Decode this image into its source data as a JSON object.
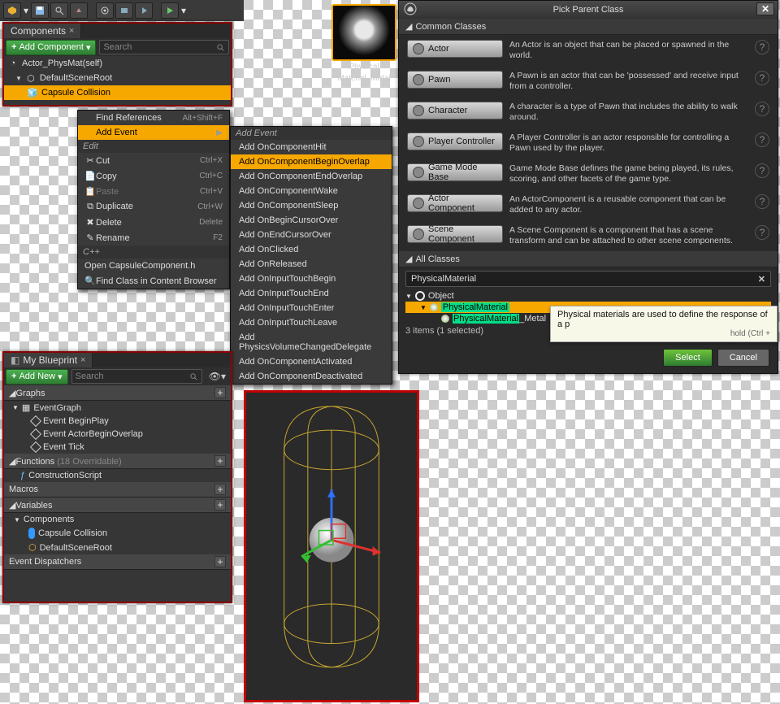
{
  "toolbar": {
    "dropdown": "▾"
  },
  "componentsPanel": {
    "tab": "Components",
    "addButton": "Add Component",
    "searchPlaceholder": "Search",
    "rootItem": "Actor_PhysMat(self)",
    "sceneRoot": "DefaultSceneRoot",
    "capsule": "Capsule Collision"
  },
  "contextMenu": {
    "findRefs": "Find References",
    "findRefsSC": "Alt+Shift+F",
    "addEvent": "Add Event",
    "editHdr": "Edit",
    "cut": "Cut",
    "cutSC": "Ctrl+X",
    "copy": "Copy",
    "copySC": "Ctrl+C",
    "paste": "Paste",
    "pasteSC": "Ctrl+V",
    "duplicate": "Duplicate",
    "duplicateSC": "Ctrl+W",
    "delete": "Delete",
    "deleteSC": "Delete",
    "rename": "Rename",
    "renameSC": "F2",
    "cppHdr": "C++",
    "openH": "Open CapsuleComponent.h",
    "findClass": "Find Class in Content Browser"
  },
  "submenu": {
    "hdr": "Add Event",
    "items": [
      "Add OnComponentHit",
      "Add OnComponentBeginOverlap",
      "Add OnComponentEndOverlap",
      "Add OnComponentWake",
      "Add OnComponentSleep",
      "Add OnBeginCursorOver",
      "Add OnEndCursorOver",
      "Add OnClicked",
      "Add OnReleased",
      "Add OnInputTouchBegin",
      "Add OnInputTouchEnd",
      "Add OnInputTouchEnter",
      "Add OnInputTouchLeave",
      "Add PhysicsVolumeChangedDelegate",
      "Add OnComponentActivated",
      "Add OnComponentDeactivated"
    ]
  },
  "myBlueprint": {
    "tab": "My Blueprint",
    "addNew": "Add New",
    "graphs": "Graphs",
    "eventGraph": "EventGraph",
    "ev1": "Event BeginPlay",
    "ev2": "Event ActorBeginOverlap",
    "ev3": "Event Tick",
    "functions": "Functions",
    "funcCount": "(18 Overridable)",
    "construction": "ConstructionScript",
    "macros": "Macros",
    "variables": "Variables",
    "componentsSub": "Components",
    "var1": "Capsule Collision",
    "var2": "DefaultSceneRoot",
    "dispatch": "Event Dispatchers"
  },
  "thumb": {
    "line1": "Physical",
    "line2": "Material_Metal"
  },
  "dialog": {
    "title": "Pick Parent Class",
    "commonHdr": "Common Classes",
    "classes": [
      {
        "name": "Actor",
        "desc": "An Actor is an object that can be placed or spawned in the world."
      },
      {
        "name": "Pawn",
        "desc": "A Pawn is an actor that can be 'possessed' and receive input from a controller."
      },
      {
        "name": "Character",
        "desc": "A character is a type of Pawn that includes the ability to walk around."
      },
      {
        "name": "Player Controller",
        "desc": "A Player Controller is an actor responsible for controlling a Pawn used by the player."
      },
      {
        "name": "Game Mode Base",
        "desc": "Game Mode Base defines the game being played, its rules, scoring, and other facets of the game type."
      },
      {
        "name": "Actor Component",
        "desc": "An ActorComponent is a reusable component that can be added to any actor."
      },
      {
        "name": "Scene Component",
        "desc": "A Scene Component is a component that has a scene transform and can be attached to other scene components."
      }
    ],
    "allHdr": "All Classes",
    "searchValue": "PhysicalMaterial",
    "treeRoot": "Object",
    "treeSel": "PhysicalMaterial",
    "treeChild": "PhysicalMaterial_Metal",
    "status": "3 items (1 selected)",
    "tooltipText": "Physical materials are used to define the response of a p",
    "tooltipHold": "hold (Ctrl +",
    "selectBtn": "Select",
    "cancelBtn": "Cancel"
  }
}
